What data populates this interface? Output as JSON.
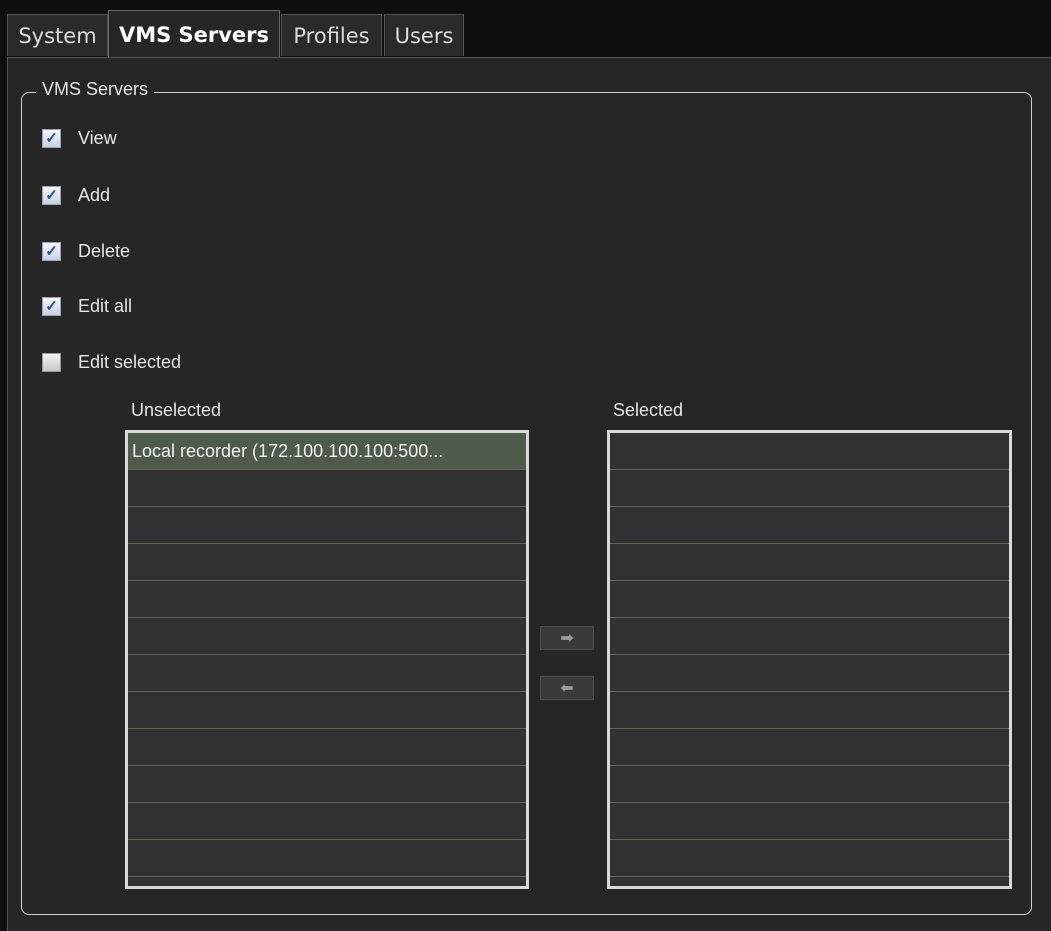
{
  "tabs": [
    {
      "label": "System",
      "active": false
    },
    {
      "label": "VMS Servers",
      "active": true
    },
    {
      "label": "Profiles",
      "active": false
    },
    {
      "label": "Users",
      "active": false
    }
  ],
  "group": {
    "title": "VMS Servers",
    "permissions": [
      {
        "label": "View",
        "checked": true
      },
      {
        "label": "Add",
        "checked": true
      },
      {
        "label": "Delete",
        "checked": true
      },
      {
        "label": "Edit all",
        "checked": true
      },
      {
        "label": "Edit selected",
        "checked": false
      }
    ]
  },
  "lists": {
    "unselected_label": "Unselected",
    "selected_label": "Selected",
    "unselected_items": [
      "Local recorder (172.100.100.100:500..."
    ],
    "selected_items": []
  },
  "buttons": {
    "move_right_icon": "arrow-right-icon",
    "move_left_icon": "arrow-left-icon"
  },
  "colors": {
    "background": "#262626",
    "selected_row": "#4e5a4a",
    "row_divider": "#5a6b54",
    "checkbox_check": "#2c4fa0"
  }
}
